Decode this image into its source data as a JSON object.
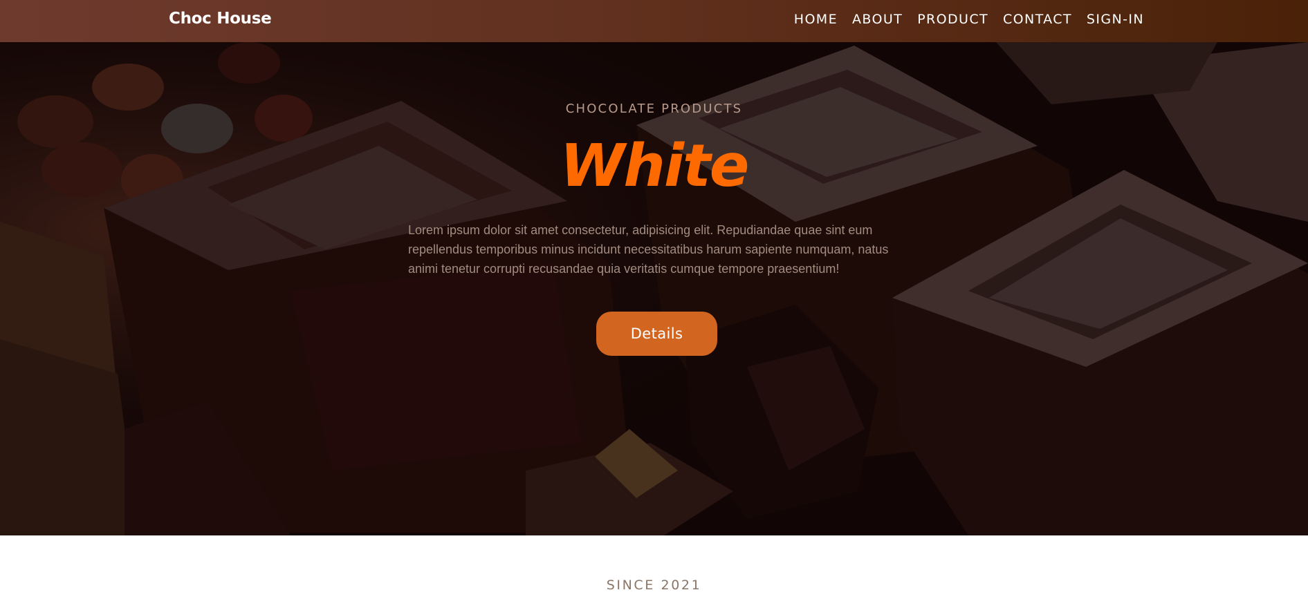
{
  "navbar": {
    "brand": "Choc House",
    "links": [
      "HOME",
      "ABOUT",
      "PRODUCT",
      "CONTACT",
      "SIGN-IN"
    ]
  },
  "hero": {
    "eyebrow": "CHOCOLATE PRODUCTS",
    "title": "White",
    "description": "Lorem ipsum dolor sit amet consectetur, adipisicing elit. Repudiandae quae sint eum repellendus temporibus minus incidunt necessitatibus harum sapiente numquam, natus animi tenetur corrupti recusandae quia veritatis cumque tempore praesentium!",
    "button_label": "Details"
  },
  "section": {
    "since": "SINCE 2021"
  },
  "colors": {
    "accent": "#ff6a00",
    "button": "#d2651f",
    "navbar_start": "#6e3a2e",
    "navbar_end": "#4a2208"
  }
}
